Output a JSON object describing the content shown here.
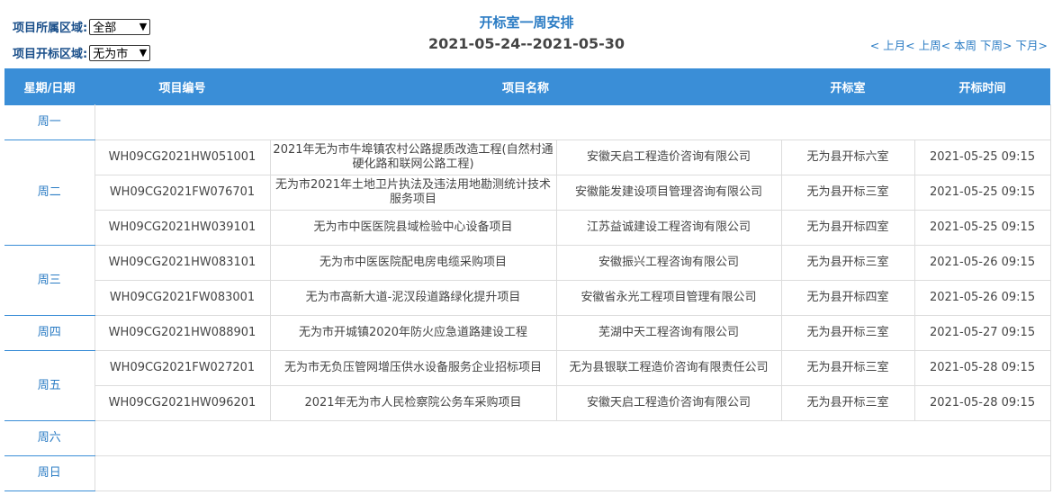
{
  "filters": {
    "region_label": "项目所属区域:",
    "region_value": "全部",
    "open_area_label": "项目开标区域:",
    "open_area_value": "无为市"
  },
  "title": "开标室一周安排",
  "date_range": "2021-05-24--2021-05-30",
  "nav": {
    "prev_month": "< 上月",
    "prev_week": "< 上周",
    "this_week": "< 本周",
    "next_week": "下周>",
    "next_month": "下月>"
  },
  "headers": [
    "星期/日期",
    "项目编号",
    "项目名称",
    "开标室",
    "开标时间"
  ],
  "days": [
    {
      "label": "周一",
      "rows": []
    },
    {
      "label": "周二",
      "rows": [
        {
          "code": "WH09CG2021HW051001",
          "name": "2021年无为市牛埠镇农村公路提质改造工程(自然村通硬化路和联网公路工程)",
          "agent": "安徽天启工程造价咨询有限公司",
          "room": "无为县开标六室",
          "time": "2021-05-25 09:15"
        },
        {
          "code": "WH09CG2021FW076701",
          "name": "无为市2021年土地卫片执法及违法用地勘测统计技术服务项目",
          "agent": "安徽能发建设项目管理咨询有限公司",
          "room": "无为县开标三室",
          "time": "2021-05-25 09:15"
        },
        {
          "code": "WH09CG2021HW039101",
          "name": "无为市中医医院县域检验中心设备项目",
          "agent": "江苏益诚建设工程咨询有限公司",
          "room": "无为县开标四室",
          "time": "2021-05-25 09:15"
        }
      ]
    },
    {
      "label": "周三",
      "rows": [
        {
          "code": "WH09CG2021HW083101",
          "name": "无为市中医医院配电房电缆采购项目",
          "agent": "安徽振兴工程咨询有限公司",
          "room": "无为县开标三室",
          "time": "2021-05-26 09:15"
        },
        {
          "code": "WH09CG2021FW083001",
          "name": "无为市高新大道-泥汊段道路绿化提升项目",
          "agent": "安徽省永光工程项目管理有限公司",
          "room": "无为县开标四室",
          "time": "2021-05-26 09:15"
        }
      ]
    },
    {
      "label": "周四",
      "rows": [
        {
          "code": "WH09CG2021HW088901",
          "name": "无为市开城镇2020年防火应急道路建设工程",
          "agent": "芜湖中天工程咨询有限公司",
          "room": "无为县开标三室",
          "time": "2021-05-27 09:15"
        }
      ]
    },
    {
      "label": "周五",
      "rows": [
        {
          "code": "WH09CG2021FW027201",
          "name": "无为市无负压管网增压供水设备服务企业招标项目",
          "agent": "无为县银联工程造价咨询有限责任公司",
          "room": "无为县开标三室",
          "time": "2021-05-28 09:15"
        },
        {
          "code": "WH09CG2021HW096201",
          "name": "2021年无为市人民检察院公务车采购项目",
          "agent": "安徽天启工程造价咨询有限公司",
          "room": "无为县开标三室",
          "time": "2021-05-28 09:15"
        }
      ]
    },
    {
      "label": "周六",
      "rows": []
    },
    {
      "label": "周日",
      "rows": []
    }
  ]
}
